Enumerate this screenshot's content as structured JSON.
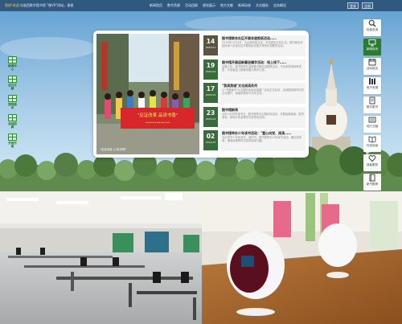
{
  "topbar": {
    "welcome_part1": "您好!欢迎",
    "welcome_part2": "光临西数字图书馆 \"微VR\"网站，谢谢",
    "nav": [
      "新闻首页",
      "数字资源",
      "活动回顾",
      "视觉展示",
      "地方文献",
      "新闻动态",
      "文化服务",
      "业务概况"
    ],
    "login": "登录",
    "register": "注册"
  },
  "left_menu": [
    {
      "label": "新闻中心"
    },
    {
      "label": "活力文献"
    },
    {
      "label": "视觉展示"
    },
    {
      "label": "活动回顾"
    },
    {
      "label": "天地万象"
    }
  ],
  "right_tools": [
    {
      "label": "检索查询",
      "icon": "search-icon"
    },
    {
      "label": "新闻资讯",
      "icon": "monitor-icon",
      "active": true
    },
    {
      "label": "活动报名",
      "icon": "calendar-icon"
    },
    {
      "label": "电子资源",
      "icon": "bookshelf-icon"
    },
    {
      "label": "数字图书",
      "icon": "ebook-icon"
    },
    {
      "label": "地方文献",
      "icon": "document-icon"
    },
    {
      "label": "在线阅读",
      "icon": "reader-icon"
    },
    {
      "label": "读者服务",
      "icon": "heart-icon"
    },
    {
      "label": "新书推荐",
      "icon": "book-icon"
    }
  ],
  "news": {
    "photo_caption": "\"见证改变 心向光明\"",
    "banner_text": "\"见证改革 品读书香\"",
    "items": [
      {
        "day": "14",
        "ym": "2019-01",
        "title": "图书馆联合社区开展非遗剪纸活动……",
        "summary": "2019年1月14日，为弘扬传统文化，丰富居民文化生活，馆内邀请非遗传承人走进社区开展剪纸讲座并现场示范教学活动。"
      },
      {
        "day": "19",
        "ym": "2019-02",
        "title": "图书馆开展迎新春送福字活动：线上线下……",
        "summary": "迎春之际，图书馆举办迎新春写福字送春联活动，书法家现场挥毫泼墨，为读者送上新春祝福与美好心愿。"
      },
      {
        "day": "17",
        "ym": "2019-03",
        "title": "\"我读我城\"文化阅读系列",
        "summary": "以\"书香城市\"为主题的全民阅读推广活动正式启动，活动围绕城市历史文化展开，读者积极参与分享交流。"
      },
      {
        "day": "23",
        "ym": "2019-04",
        "title": "图书馆新闻",
        "summary": "4月23日世界读书日，图书馆举办主题系列活动，开展经典诵读、图书漂流、阅读分享会等形式多样的活动。"
      },
      {
        "day": "02",
        "ym": "2019-05",
        "title": "图书馆举办少年读书活动：\"童心向党、阅读……",
        "summary": "为引导青少年多读书、读好书，图书馆举办少年读书活动，通过讲故事、诵读经典等形式激发阅读兴趣。"
      }
    ]
  },
  "colors": {
    "primary_green": "#2d7a33",
    "date_green": "#3a6b3a",
    "topbar_blue": "#26496e",
    "banner_red": "#d8272b"
  }
}
